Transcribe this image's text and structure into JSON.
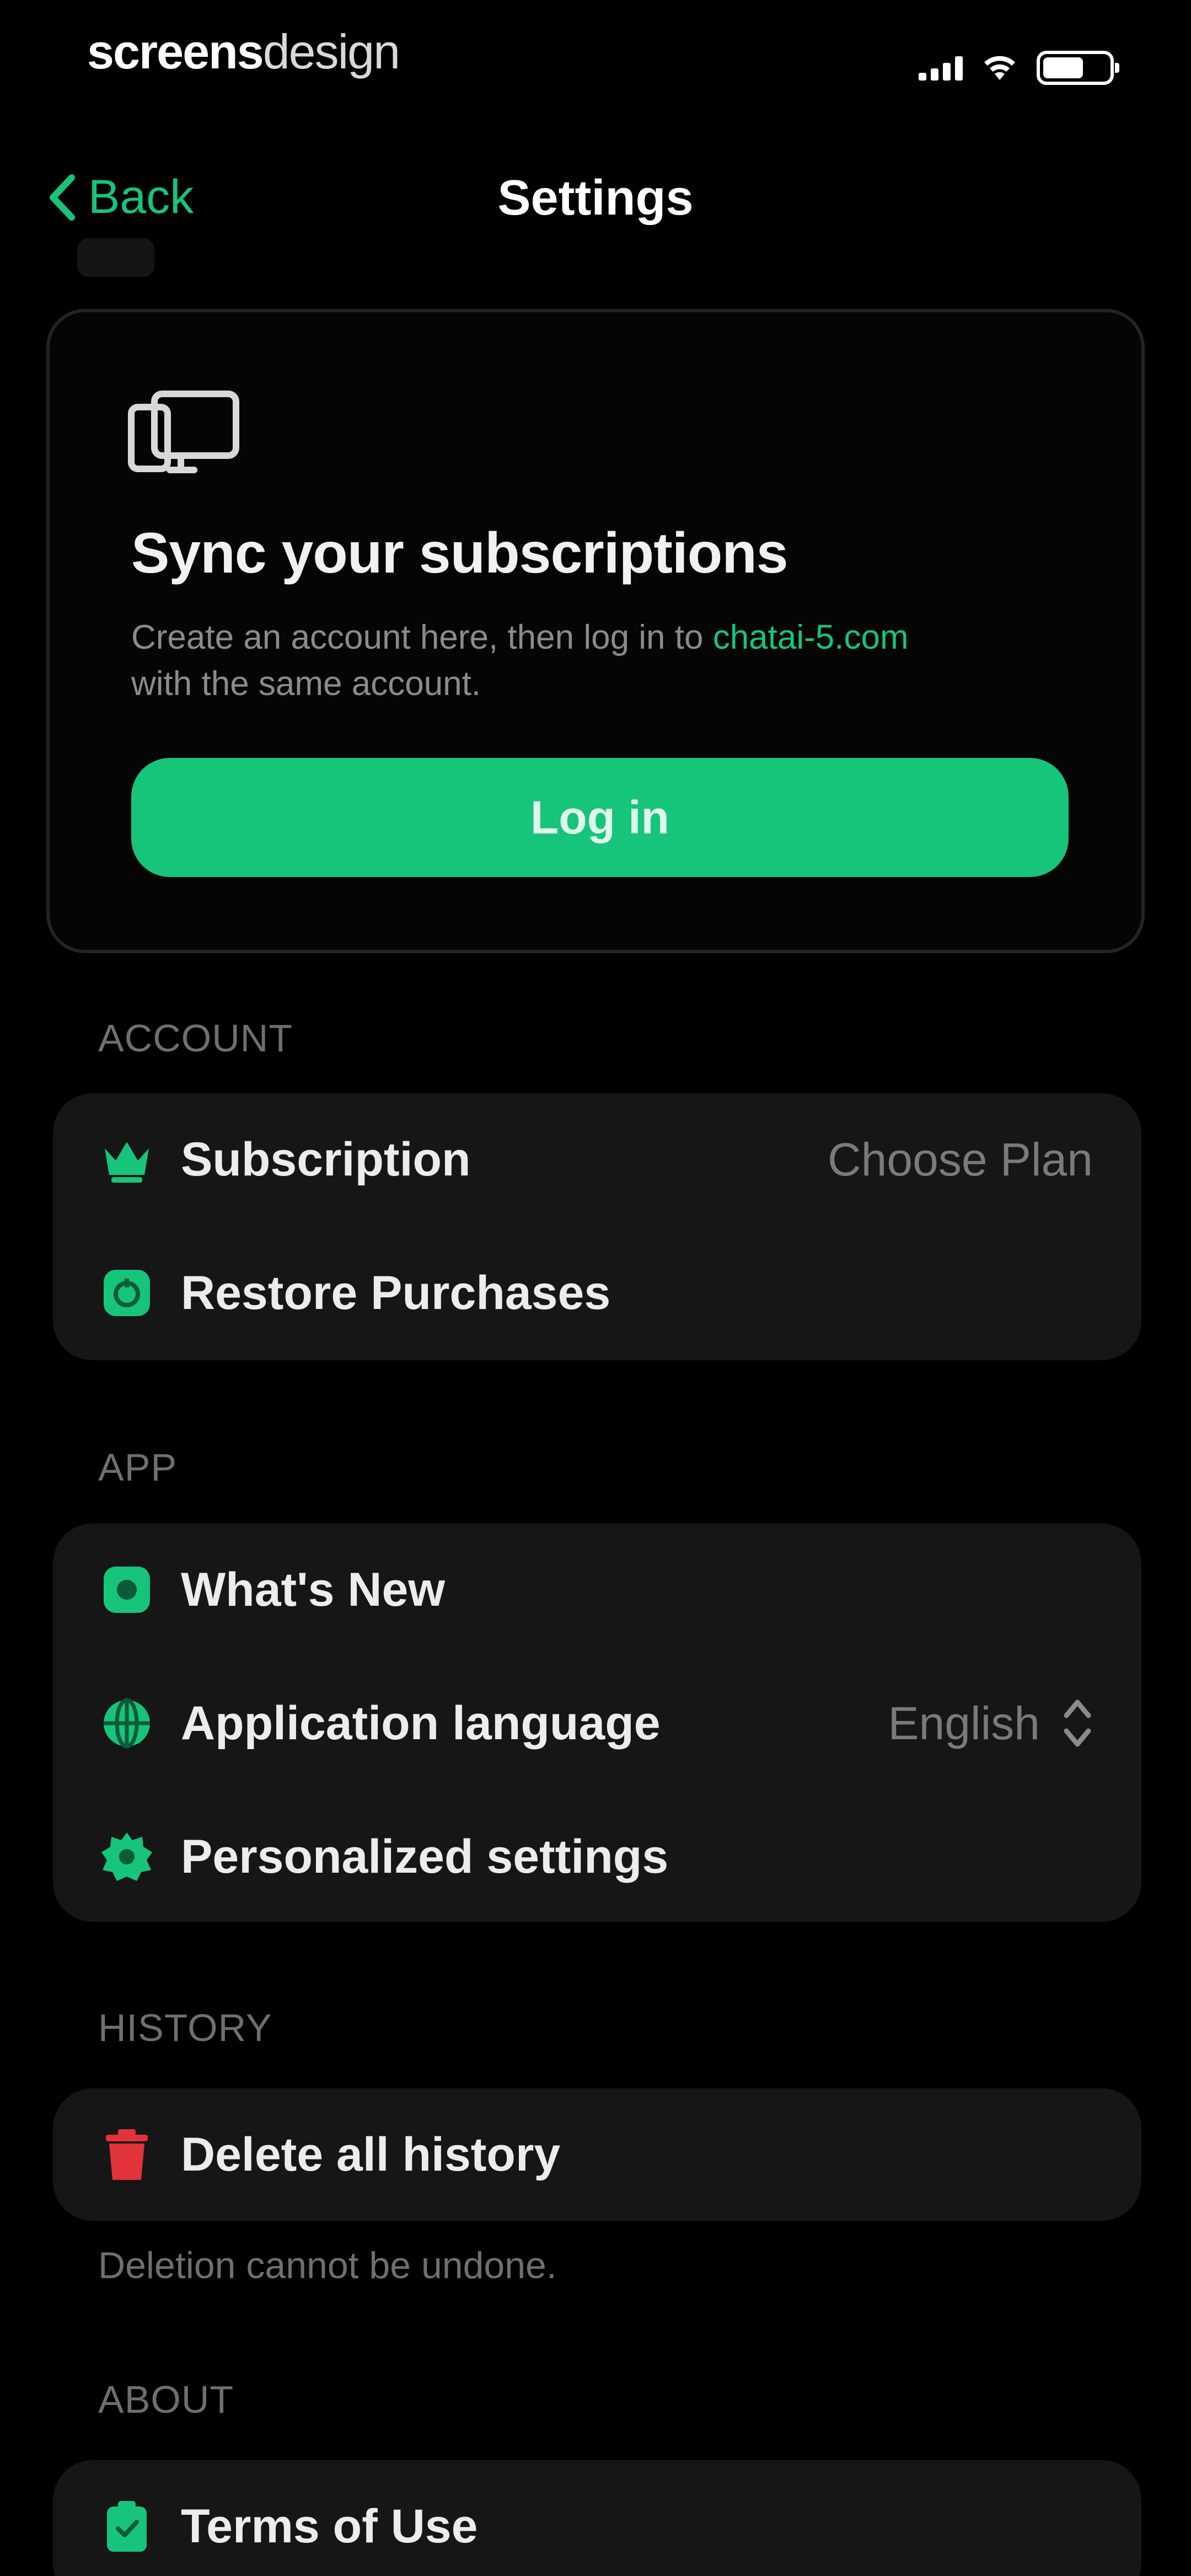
{
  "statusbar": {
    "logo_bold": "screens",
    "logo_thin": "design"
  },
  "nav": {
    "back_label": "Back",
    "title": "Settings"
  },
  "sync_card": {
    "title": "Sync your subscriptions",
    "desc_prefix": "Create an account here, then log in to ",
    "desc_link": "chatai-5.com",
    "desc_suffix": "with the same account.",
    "login_label": "Log in"
  },
  "sections": {
    "account": {
      "label": "ACCOUNT",
      "items": [
        {
          "label": "Subscription",
          "value": "Choose Plan",
          "icon": "crown-icon"
        },
        {
          "label": "Restore Purchases",
          "value": "",
          "icon": "restore-icon"
        }
      ]
    },
    "app": {
      "label": "APP",
      "items": [
        {
          "label": "What's New",
          "value": "",
          "icon": "whats-new-icon"
        },
        {
          "label": "Application language",
          "value": "English",
          "icon": "globe-icon"
        },
        {
          "label": "Personalized settings",
          "value": "",
          "icon": "gear-icon"
        }
      ]
    },
    "history": {
      "label": "HISTORY",
      "items": [
        {
          "label": "Delete all history",
          "value": "",
          "icon": "trash-icon"
        }
      ],
      "footnote": "Deletion cannot be undone."
    },
    "about": {
      "label": "ABOUT",
      "items": [
        {
          "label": "Terms of Use",
          "value": "",
          "icon": "document-icon"
        }
      ]
    }
  },
  "colors": {
    "accent": "#16c47a",
    "danger": "#e2323a",
    "background": "#000000",
    "group": "#161616"
  }
}
